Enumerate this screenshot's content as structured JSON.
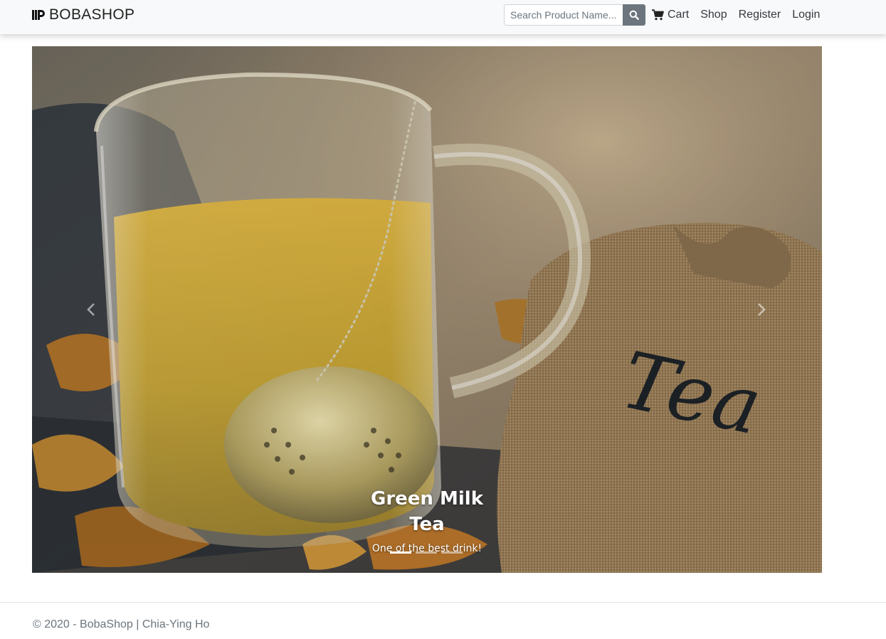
{
  "navbar": {
    "brand": "BOBASHOP",
    "search": {
      "placeholder": "Search Product Name..."
    },
    "links": {
      "cart": "Cart",
      "shop": "Shop",
      "register": "Register",
      "login": "Login"
    },
    "icons": {
      "brand": "cup-icon",
      "search": "search-icon",
      "cart": "cart-icon"
    }
  },
  "carousel": {
    "slide": {
      "title": "Green Milk Tea",
      "subtitle": "One of the best drink!"
    },
    "indicators": {
      "count": 3,
      "active_index": 0
    },
    "controls": {
      "prev": "chevron-left-icon",
      "next": "chevron-right-icon"
    }
  },
  "footer": {
    "prefix": "© 2020 - ",
    "link": "BobaShop",
    "suffix": " | Chia-Ying Ho"
  },
  "colors": {
    "navbar_bg": "#f8f9fa",
    "search_button": "#6c757d",
    "footer_text": "#6c757d"
  }
}
